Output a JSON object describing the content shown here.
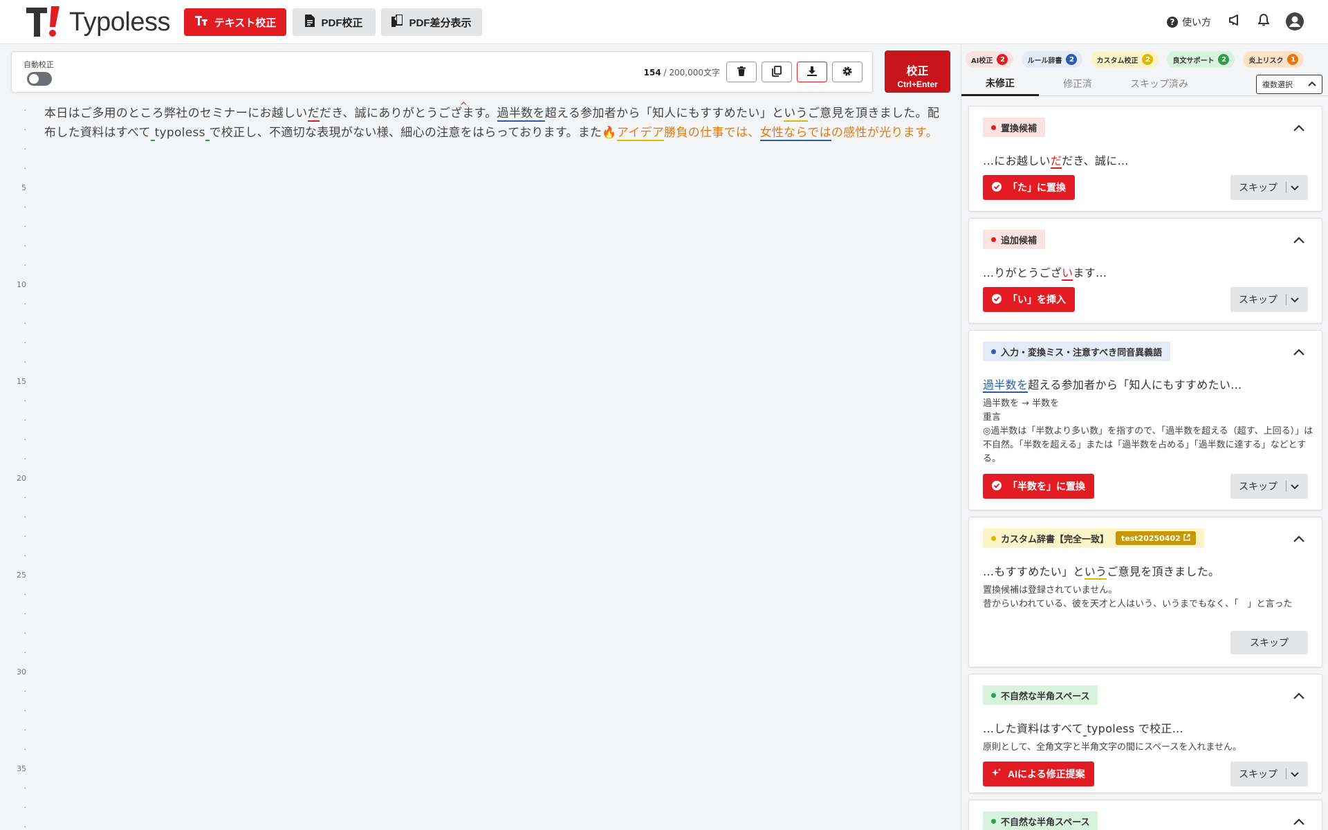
{
  "colors": {
    "brand": "#e31c23",
    "ai": "#e31c23",
    "rule": "#2a5db0",
    "custom": "#e0b800",
    "style": "#2e9e48",
    "risk": "#e8780c"
  },
  "header": {
    "logo_text": "Typoless",
    "nav": [
      {
        "label": "テキスト校正",
        "icon": "text-format-icon",
        "active": true
      },
      {
        "label": "PDF校正",
        "icon": "document-icon",
        "active": false
      },
      {
        "label": "PDF差分表示",
        "icon": "pdf-diff-icon",
        "active": false
      }
    ],
    "help_label": "使い方",
    "icons": [
      "megaphone-icon",
      "bell-icon",
      "user-avatar-icon"
    ]
  },
  "toolbar": {
    "auto_label": "自動校正",
    "auto_enabled": false,
    "count": "154",
    "count_suffix": " / 200,000文字",
    "check_label": "校正",
    "check_shortcut": "Ctrl+Enter"
  },
  "gutter": [
    "5",
    "10",
    "15",
    "20",
    "25",
    "30",
    "35"
  ],
  "editor": {
    "segments": [
      {
        "t": "本日はご多用のところ弊社のセミナーにお越しい"
      },
      {
        "t": "だ",
        "u": "red"
      },
      {
        "t": "だき、誠にありがとうござ"
      },
      {
        "t": "ます。",
        "caret": true
      },
      {
        "t": "過半数を",
        "u": "blue"
      },
      {
        "t": "超える参加者から「知人にもすすめたい」と"
      },
      {
        "t": "いう",
        "u": "yellow"
      },
      {
        "t": "ご意見を頂きました。配布した資料はすべて"
      },
      {
        "t": " ",
        "u": "green"
      },
      {
        "t": "typoless"
      },
      {
        "t": " ",
        "u": "green"
      },
      {
        "t": "で校正し、不適切な表現がない様、細心の注意をはらっております。また🔥"
      },
      {
        "t": "アイデア",
        "u": "yellow",
        "c": "orange"
      },
      {
        "t": "勝負の仕事では、",
        "c": "orange"
      },
      {
        "t": "女性ならでは",
        "u": "blue",
        "c": "orange"
      },
      {
        "t": "の感性が光ります。",
        "c": "orange"
      }
    ]
  },
  "panel": {
    "filters": [
      {
        "label": "AI校正",
        "count": "2",
        "bg": "#fbe3e3",
        "dot": "#e31c23"
      },
      {
        "label": "ルール辞書",
        "count": "2",
        "bg": "#e2ebf6",
        "dot": "#2a5db0"
      },
      {
        "label": "カスタム校正",
        "count": "2",
        "bg": "#fcf3c6",
        "dot": "#e0b800"
      },
      {
        "label": "良文サポート",
        "count": "2",
        "bg": "#d9f2de",
        "dot": "#2e9e48"
      },
      {
        "label": "炎上リスク",
        "count": "1",
        "bg": "#fde2c8",
        "dot": "#e8780c"
      }
    ],
    "tabs": [
      "未修正",
      "修正済",
      "スキップ済み"
    ],
    "multi_select": "複数選択",
    "skip_label": "スキップ",
    "cards": [
      {
        "badge": "置換候補",
        "ctx_pre": "…にお越しい",
        "ctx_hl": "だ",
        "ctx_post": "だき、誠に…",
        "action": "「た」に置換"
      },
      {
        "badge": "追加候補",
        "ctx_pre": "…りがとうござ",
        "ctx_hl": "い",
        "ctx_post": "ます…",
        "action": "「い」を挿入"
      },
      {
        "badge": "入力・変換ミス・注意すべき同音異義語",
        "ctx_hl": "過半数を",
        "ctx_post": "超える参加者から「知人にもすすめたい…",
        "detail": [
          "過半数を → 半数を",
          "重言",
          "◎過半数は「半数より多い数」を指すので、「過半数を超える（超す、上回る）」は不自然。「半数を超える」または「過半数を占める」「過半数に達する」などとする。"
        ],
        "action": "「半数を」に置換"
      },
      {
        "badge": "カスタム辞書【完全一致】",
        "tag": "test20250402",
        "ctx_pre": "…もすすめたい」と",
        "ctx_hl": "いう",
        "ctx_post": "ご意見を頂きました。",
        "detail": [
          "置換候補は登録されていません。",
          "昔からいわれている、彼を天才と人はいう、いうまでもなく、「　」と言った"
        ]
      },
      {
        "badge": "不自然な半角スペース",
        "ctx_pre": "…した資料はすべて",
        "ctx_hl": " ",
        "ctx_post": "typoless で校正…",
        "detail": [
          "原則として、全角文字と半角文字の間にスペースを入れません。"
        ],
        "action": "AIによる修正提案"
      },
      {
        "badge": "不自然な半角スペース"
      }
    ]
  }
}
